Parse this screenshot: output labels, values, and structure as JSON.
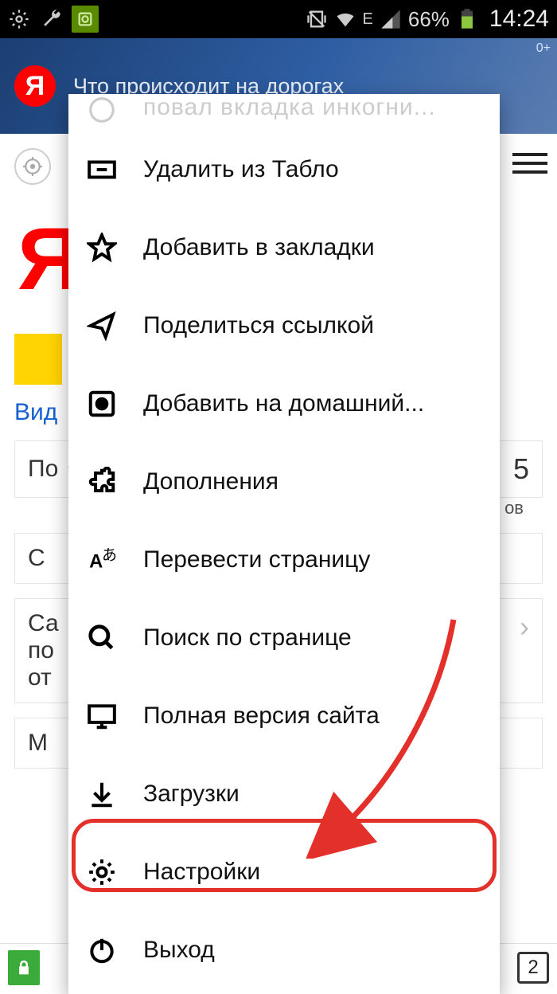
{
  "status_bar": {
    "battery": "66%",
    "time": "14:24",
    "network_label": "E"
  },
  "banner": {
    "badge": "Я",
    "text": "Что происходит на дорогах",
    "age": "0+"
  },
  "page": {
    "logo": "Я",
    "video_link": "Вид",
    "weather_prefix": "По",
    "weather_right": "5",
    "weather_right_sub": "ов",
    "card2_line1": "С",
    "card3_line1": "Са",
    "card3_line2": "по",
    "card3_line3": "от",
    "card4_line1": "М"
  },
  "menu": {
    "cut_item": "повал вкладка инкогни...",
    "items": [
      {
        "id": "remove-tablo",
        "label": "Удалить из Табло",
        "icon": "remove-tablo-icon"
      },
      {
        "id": "add-bookmark",
        "label": "Добавить в закладки",
        "icon": "star-icon"
      },
      {
        "id": "share-link",
        "label": "Поделиться ссылкой",
        "icon": "share-icon"
      },
      {
        "id": "add-homescreen",
        "label": "Добавить на домашний...",
        "icon": "circle-dot-icon"
      },
      {
        "id": "extensions",
        "label": "Дополнения",
        "icon": "puzzle-icon"
      },
      {
        "id": "translate",
        "label": "Перевести страницу",
        "icon": "translate-icon"
      },
      {
        "id": "find-in-page",
        "label": "Поиск по странице",
        "icon": "search-icon"
      },
      {
        "id": "desktop-site",
        "label": "Полная версия сайта",
        "icon": "desktop-icon"
      },
      {
        "id": "downloads",
        "label": "Загрузки",
        "icon": "download-icon"
      },
      {
        "id": "settings",
        "label": "Настройки",
        "icon": "gear-icon"
      },
      {
        "id": "exit",
        "label": "Выход",
        "icon": "power-icon"
      }
    ]
  },
  "bottom_bar": {
    "tabs": "2"
  },
  "highlight": {
    "target_index": 9
  }
}
